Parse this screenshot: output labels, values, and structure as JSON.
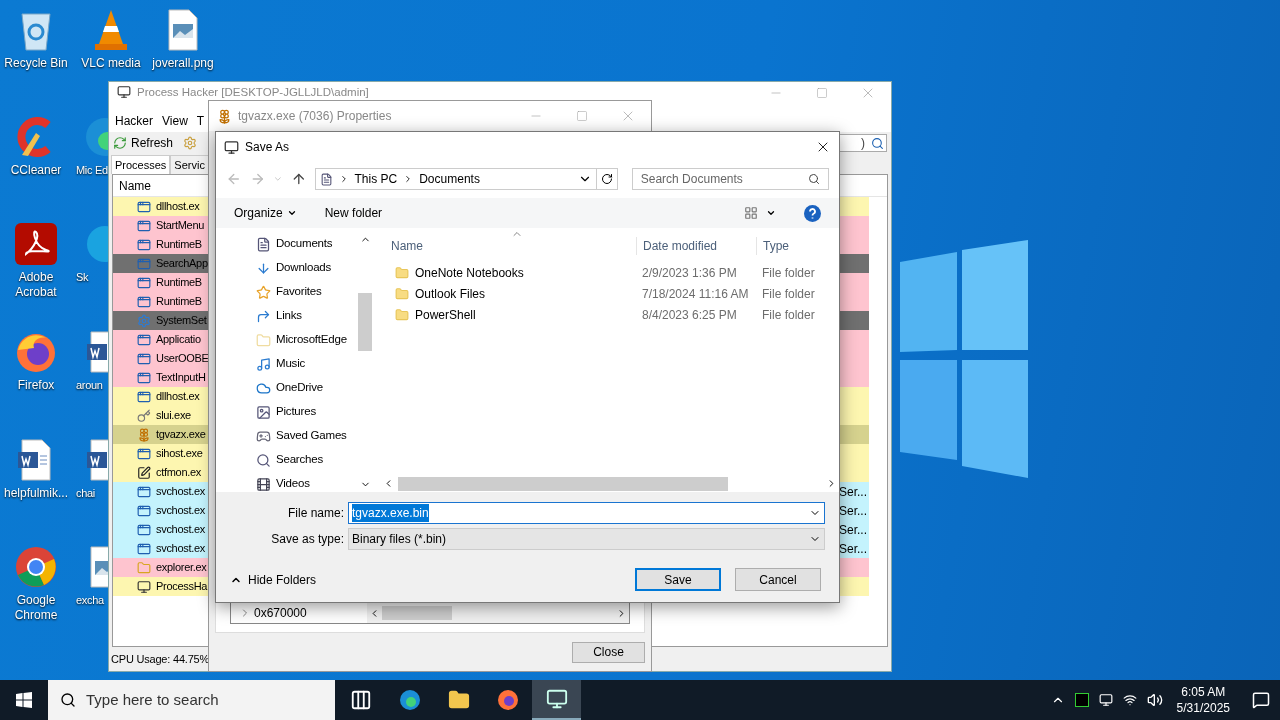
{
  "desktop": {
    "icon_columns": [
      [
        {
          "kind": "recycle-bin",
          "label": "Recycle Bin"
        },
        {
          "kind": "ccleaner",
          "label": "CCleaner"
        },
        {
          "kind": "acrobat",
          "label": "Adobe Acrobat"
        },
        {
          "kind": "firefox",
          "label": "Firefox"
        },
        {
          "kind": "word",
          "label": "helpfulmik..."
        },
        {
          "kind": "chrome",
          "label": "Google Chrome"
        }
      ],
      [
        {
          "kind": "vlc",
          "label": "VLC media"
        },
        {
          "kind": "edge",
          "label": "Mic Ed"
        },
        {
          "kind": "skype",
          "label": "Sk"
        },
        {
          "kind": "word",
          "label": "aroun"
        },
        {
          "kind": "word",
          "label": "chai"
        },
        {
          "kind": "image",
          "label": "excha"
        }
      ],
      [
        {
          "kind": "image",
          "label": "joverall.png"
        }
      ]
    ]
  },
  "process_hacker": {
    "title": "Process Hacker [DESKTOP-JGLLJLD\\admin]",
    "menu": [
      "Hacker",
      "View",
      "T"
    ],
    "toolbar": [
      "Refresh"
    ],
    "search": {
      "placeholder": ")"
    },
    "tabs": [
      {
        "label": "Processes",
        "selected": true
      },
      {
        "label": "Servic",
        "selected": false
      }
    ],
    "column": "Name",
    "rows": [
      {
        "kind": "app",
        "name": "dllhost.ex",
        "color": "#fdf6b0"
      },
      {
        "kind": "app",
        "name": "StartMenu",
        "color": "#fec4cf"
      },
      {
        "kind": "app",
        "name": "RuntimeB",
        "color": "#fec4cf"
      },
      {
        "kind": "app",
        "name": "SearchApp",
        "color": "#707070"
      },
      {
        "kind": "app",
        "name": "RuntimeB",
        "color": "#fec4cf"
      },
      {
        "kind": "app",
        "name": "RuntimeB",
        "color": "#fec4cf"
      },
      {
        "kind": "settings",
        "name": "SystemSet",
        "color": "#707070"
      },
      {
        "kind": "app",
        "name": "Applicatio",
        "color": "#fec4cf"
      },
      {
        "kind": "app",
        "name": "UserOOBE",
        "color": "#fec4cf"
      },
      {
        "kind": "app",
        "name": "TextInputH",
        "color": "#fec4cf"
      },
      {
        "kind": "app",
        "name": "dllhost.ex",
        "color": "#fdf6b0"
      },
      {
        "kind": "key",
        "name": "slui.exe",
        "color": "#fdf6b0"
      },
      {
        "kind": "flower",
        "name": "tgvazx.exe",
        "color": "#d6d28e"
      },
      {
        "kind": "app",
        "name": "sihost.exe",
        "color": "#fdf6b0"
      },
      {
        "kind": "editor",
        "name": "ctfmon.ex",
        "color": "#fdf6b0"
      },
      {
        "kind": "app",
        "name": "svchost.ex",
        "color": "#c4f3fd",
        "column_2": "Ser..."
      },
      {
        "kind": "app",
        "name": "svchost.ex",
        "color": "#c4f3fd",
        "column_2": "Ser..."
      },
      {
        "kind": "app",
        "name": "svchost.ex",
        "color": "#c4f3fd",
        "column_2": "Ser..."
      },
      {
        "kind": "app",
        "name": "svchost.ex",
        "color": "#c4f3fd",
        "column_2": "Ser..."
      },
      {
        "kind": "explorer",
        "name": "explorer.ex",
        "color": "#fec4cf"
      },
      {
        "kind": "monitor",
        "name": "ProcessHa",
        "color": "#fdf6b0"
      }
    ],
    "status": "CPU Usage: 44.75%"
  },
  "properties": {
    "title": "tgvazx.exe (7036) Properties",
    "tree_row": "0x670000",
    "close": "Close"
  },
  "save_as": {
    "title": "Save As",
    "path": [
      "This PC",
      "Documents"
    ],
    "search": {
      "placeholder": "Search Documents"
    },
    "organize": "Organize",
    "new_folder": "New folder",
    "nav": [
      {
        "kind": "documents",
        "label": "Documents"
      },
      {
        "kind": "downloads",
        "label": "Downloads"
      },
      {
        "kind": "favorites",
        "label": "Favorites"
      },
      {
        "kind": "links",
        "label": "Links"
      },
      {
        "kind": "folder",
        "label": "MicrosoftEdge"
      },
      {
        "kind": "music",
        "label": "Music"
      },
      {
        "kind": "onedrive",
        "label": "OneDrive"
      },
      {
        "kind": "pictures",
        "label": "Pictures"
      },
      {
        "kind": "games",
        "label": "Saved Games"
      },
      {
        "kind": "searches",
        "label": "Searches"
      },
      {
        "kind": "videos",
        "label": "Videos"
      }
    ],
    "columns": [
      "Name",
      "Date modified",
      "Type"
    ],
    "files": [
      {
        "name": "OneNote Notebooks",
        "date": "2/9/2023 1:36 PM",
        "type": "File folder"
      },
      {
        "name": "Outlook Files",
        "date": "7/18/2024 11:16 AM",
        "type": "File folder"
      },
      {
        "name": "PowerShell",
        "date": "8/4/2023 6:25 PM",
        "type": "File folder"
      }
    ],
    "file_name_label": "File name:",
    "file_name": "tgvazx.exe.bin",
    "type_label": "Save as type:",
    "type": "Binary files (*.bin)",
    "hide_folders": "Hide Folders",
    "save": "Save",
    "cancel": "Cancel"
  },
  "taskbar": {
    "search": {
      "placeholder": "Type here to search"
    },
    "apps": [
      {
        "kind": "task-view",
        "selected": false
      },
      {
        "kind": "edge",
        "selected": false
      },
      {
        "kind": "explorer",
        "selected": false
      },
      {
        "kind": "firefox",
        "selected": false
      },
      {
        "kind": "monitor",
        "selected": true
      }
    ],
    "time": "6:05 AM",
    "date": "5/31/2025"
  }
}
